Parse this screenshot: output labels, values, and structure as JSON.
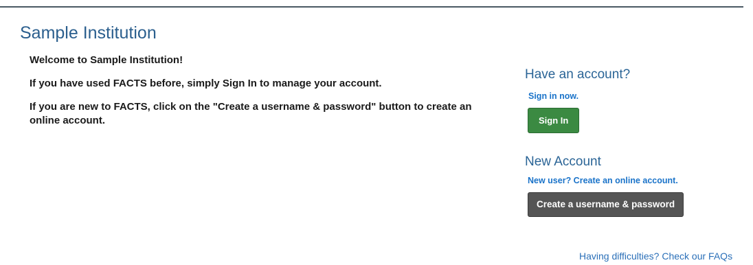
{
  "page": {
    "title": "Sample Institution"
  },
  "intro": {
    "welcome": "Welcome to Sample Institution!",
    "returning": "If you have used FACTS before, simply Sign In to manage your account.",
    "new_user": "If you are new to FACTS, click on the \"Create a username & password\" button to create an online account."
  },
  "existing_account": {
    "heading": "Have an account?",
    "link_text": "Sign in now.",
    "button_label": "Sign In"
  },
  "new_account": {
    "heading": "New Account",
    "link_text": "New user? Create an online account.",
    "button_label": "Create a username & password"
  },
  "footer": {
    "faq_link": "Having difficulties? Check our FAQs"
  },
  "colors": {
    "title": "#2b5f8e",
    "link": "#1a73c9",
    "sign_in_button": "#3b8a42",
    "create_button": "#555555"
  }
}
